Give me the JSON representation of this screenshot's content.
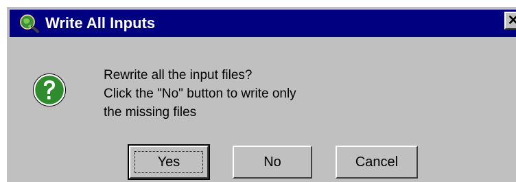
{
  "window": {
    "title": "Write All Inputs",
    "close_glyph": "✕",
    "app_icon": "globe-magnifier-icon",
    "titlebar_color": "#000080",
    "face_color": "#c0c0c0"
  },
  "message": {
    "icon": "question-icon",
    "icon_color": "#2e8b2e",
    "lines": [
      "Rewrite all the input files?",
      "Click the \"No\" button to write only",
      "the missing files"
    ]
  },
  "buttons": {
    "yes": "Yes",
    "no": "No",
    "cancel": "Cancel",
    "default": "yes"
  }
}
